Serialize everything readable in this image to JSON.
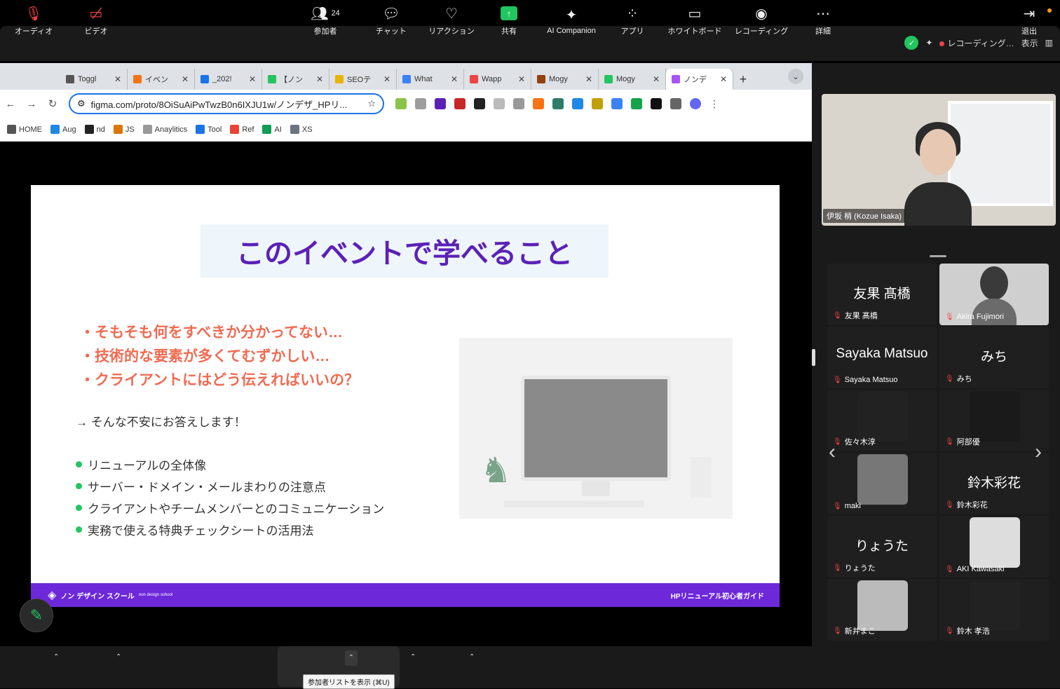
{
  "zoom_header": {
    "recording_label": "レコーディング…",
    "view_label": "表示"
  },
  "browser": {
    "tabs": [
      {
        "label": "Toggl",
        "color": "#555555"
      },
      {
        "label": "イベン",
        "color": "#f97316"
      },
      {
        "label": "_202!",
        "color": "#1a73e8"
      },
      {
        "label": "【ノン",
        "color": "#22c55e"
      },
      {
        "label": "SEOテ",
        "color": "#eab308"
      },
      {
        "label": "What",
        "color": "#3b82f6"
      },
      {
        "label": "Wapp",
        "color": "#ef4444"
      },
      {
        "label": "Mogy",
        "color": "#92400e"
      },
      {
        "label": "Mogy",
        "color": "#22c55e"
      },
      {
        "label": "ノンデ",
        "color": "#a855f7"
      }
    ],
    "url": "figma.com/proto/8OiSuAiPwTwzB0n6IXJU1w/ノンデザ_HPリ...",
    "bookmarks": [
      "HOME",
      "Aug",
      "nd",
      "JS",
      "Anaylitics",
      "Tool",
      "Ref",
      "AI",
      "XS"
    ]
  },
  "slide": {
    "title": "このイベントで学べること",
    "pains": [
      "・そもそも何をすべきか分かってない…",
      "・技術的な要素が多くてむずかしい…",
      "・クライアントにはどう伝えればいいの？"
    ],
    "answer": "→ そんな不安にお答えします！",
    "bullets": [
      "リニューアルの全体像",
      "サーバー・ドメイン・メールまわりの注意点",
      "クライアントやチームメンバーとのコミュニケーション",
      "実務で使える特典チェックシートの活用法"
    ],
    "footer_left": "ノン デザイン スクール",
    "footer_left_sub": "non design school",
    "footer_right": "HPリニューアル初心者ガイド"
  },
  "speaker": {
    "name": "伊坂 梢 (Kozue Isaka)"
  },
  "gallery": [
    {
      "big": "友果 髙橋",
      "name": "友果 髙橋"
    },
    {
      "big": "",
      "name": "Akira Fujimori",
      "video": true
    },
    {
      "big": "Sayaka Matsuo",
      "name": "Sayaka Matsuo"
    },
    {
      "big": "みち",
      "name": "みち"
    },
    {
      "big": "",
      "name": "佐々木淳",
      "avatar": true
    },
    {
      "big": "",
      "name": "阿部優",
      "avatar": true
    },
    {
      "big": "",
      "name": "maki",
      "avatar": true
    },
    {
      "big": "鈴木彩花",
      "name": "鈴木彩花"
    },
    {
      "big": "りょうた",
      "name": "りょうた"
    },
    {
      "big": "",
      "name": "AKI Kawasaki",
      "avatar": true
    },
    {
      "big": "",
      "name": "新井まこ",
      "avatar": true
    },
    {
      "big": "",
      "name": "鈴木 孝浩",
      "avatar": true
    }
  ],
  "toolbar": {
    "audio": "オーディオ",
    "video": "ビデオ",
    "participants_count": "24",
    "participants": "参加者",
    "chat": "チャット",
    "reaction": "リアクション",
    "share": "共有",
    "ai": "AI Companion",
    "apps": "アプリ",
    "whiteboard": "ホワイトボード",
    "recording": "レコーディング",
    "more": "詳細",
    "leave": "退出",
    "tooltip": "参加者リストを表示 (⌘U)"
  },
  "colors": {
    "accent_purple": "#6d28d9",
    "pain_red": "#f06b52",
    "green": "#22c55e"
  }
}
